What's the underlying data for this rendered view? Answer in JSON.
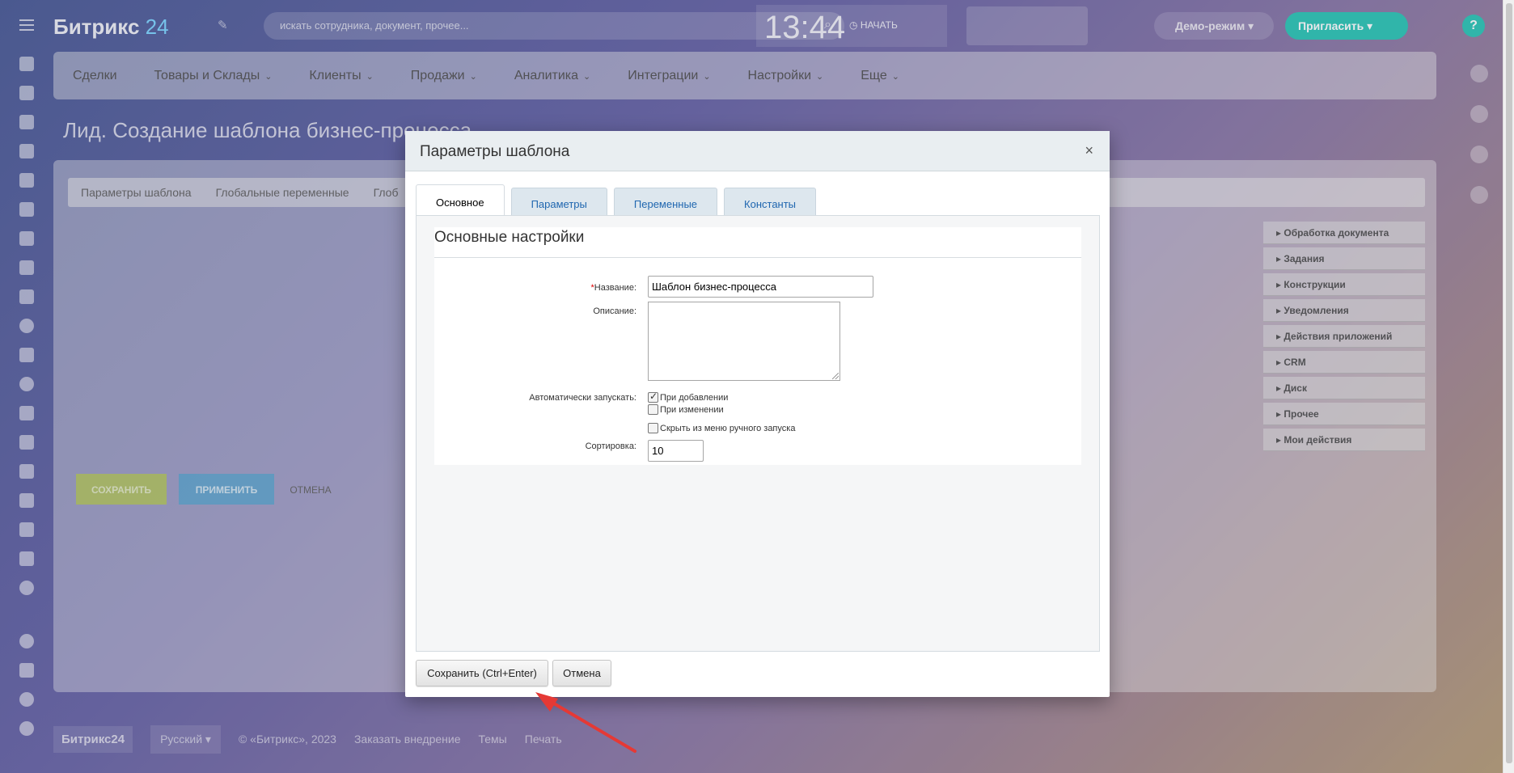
{
  "app": {
    "logo_text": "Битрикс",
    "logo_num": "24",
    "search_placeholder": "искать сотрудника, документ, прочее...",
    "clock": "13:44",
    "start_label": "НАЧАТЬ",
    "demo_label": "Демо-режим",
    "invite_label": "Пригласить",
    "help_label": "?"
  },
  "nav": [
    {
      "label": "Сделки",
      "chev": ""
    },
    {
      "label": "Товары и Склады",
      "chev": "⌄"
    },
    {
      "label": "Клиенты",
      "chev": "⌄"
    },
    {
      "label": "Продажи",
      "chev": "⌄"
    },
    {
      "label": "Аналитика",
      "chev": "⌄"
    },
    {
      "label": "Интеграции",
      "chev": "⌄"
    },
    {
      "label": "Настройки",
      "chev": "⌄"
    },
    {
      "label": "Еще",
      "chev": "⌄"
    }
  ],
  "page": {
    "title": "Лид. Создание шаблона бизнес-процесса",
    "tabs": [
      "Параметры шаблона",
      "Глобальные переменные",
      "Глоб"
    ],
    "save": "СОХРАНИТЬ",
    "apply": "ПРИМЕНИТЬ",
    "cancel": "ОТМЕНА"
  },
  "groups": [
    "Обработка документа",
    "Задания",
    "Конструкции",
    "Уведомления",
    "Действия приложений",
    "CRM",
    "Диск",
    "Прочее",
    "Мои действия"
  ],
  "footer": {
    "brand": "Битрикс24",
    "lang": "Русский",
    "copyright": "© «Битрикс», 2023",
    "order": "Заказать внедрение",
    "themes": "Темы",
    "print": "Печать"
  },
  "dialog": {
    "title": "Параметры шаблона",
    "close": "×",
    "tabs": [
      "Основное",
      "Параметры",
      "Переменные",
      "Константы"
    ],
    "section_title": "Основные настройки",
    "name_req": "*",
    "name_label": "Название:",
    "name_value": "Шаблон бизнес-процесса",
    "desc_label": "Описание:",
    "auto_label": "Автоматически запускать:",
    "on_add": "При добавлении",
    "on_change": "При изменении",
    "hide_menu": "Скрыть из меню ручного запуска",
    "sort_label": "Сортировка:",
    "sort_value": "10",
    "save_btn": "Сохранить (Ctrl+Enter)",
    "cancel_btn": "Отмена"
  },
  "colors": {
    "accent": "#2fc6b7",
    "annotation_arrow": "#e53935"
  }
}
